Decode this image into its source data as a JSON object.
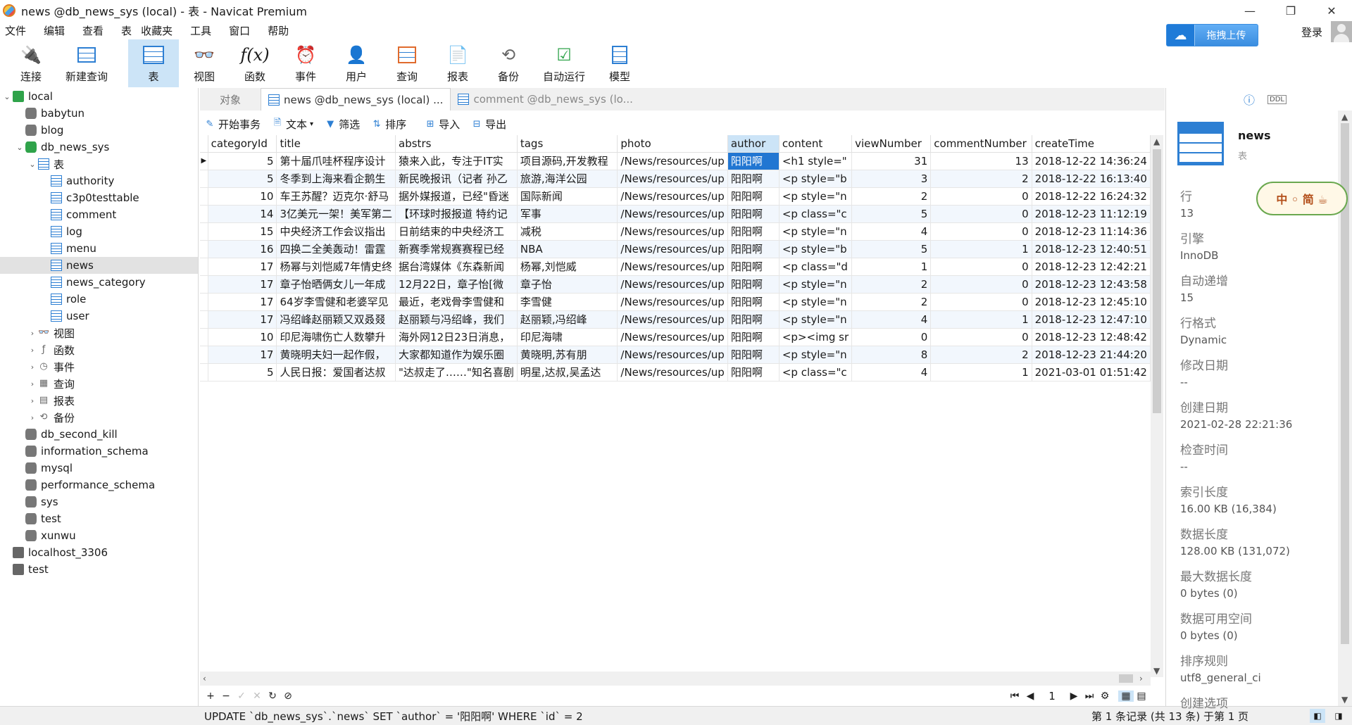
{
  "window": {
    "title": "news @db_news_sys (local) - 表 - Navicat Premium",
    "controls": [
      "—",
      "❐",
      "✕"
    ]
  },
  "menu": [
    "文件",
    "编辑",
    "查看",
    "表",
    "收藏夹",
    "工具",
    "窗口",
    "帮助"
  ],
  "top_right": {
    "upload_label": "拖拽上传",
    "login_label": "登录"
  },
  "toolbar": [
    {
      "label": "连接",
      "icon": "plug-icon"
    },
    {
      "label": "新建查询",
      "icon": "new-query-icon"
    },
    {
      "label": "表",
      "icon": "table-icon",
      "active": true
    },
    {
      "label": "视图",
      "icon": "view-icon"
    },
    {
      "label": "函数",
      "icon": "function-icon"
    },
    {
      "label": "事件",
      "icon": "clock-icon"
    },
    {
      "label": "用户",
      "icon": "user-icon"
    },
    {
      "label": "查询",
      "icon": "query-icon"
    },
    {
      "label": "报表",
      "icon": "report-icon"
    },
    {
      "label": "备份",
      "icon": "backup-icon"
    },
    {
      "label": "自动运行",
      "icon": "automation-icon"
    },
    {
      "label": "模型",
      "icon": "model-icon"
    }
  ],
  "tree": [
    {
      "label": "local",
      "depth": 0,
      "kind": "conn",
      "tw": "⌄"
    },
    {
      "label": "babytun",
      "depth": 1,
      "kind": "db"
    },
    {
      "label": "blog",
      "depth": 1,
      "kind": "db"
    },
    {
      "label": "db_news_sys",
      "depth": 1,
      "kind": "db-open",
      "tw": "⌄"
    },
    {
      "label": "表",
      "depth": 2,
      "kind": "table",
      "tw": "⌄"
    },
    {
      "label": "authority",
      "depth": 3,
      "kind": "table"
    },
    {
      "label": "c3p0testtable",
      "depth": 3,
      "kind": "table"
    },
    {
      "label": "comment",
      "depth": 3,
      "kind": "table"
    },
    {
      "label": "log",
      "depth": 3,
      "kind": "table"
    },
    {
      "label": "menu",
      "depth": 3,
      "kind": "table"
    },
    {
      "label": "news",
      "depth": 3,
      "kind": "table",
      "selected": true
    },
    {
      "label": "news_category",
      "depth": 3,
      "kind": "table"
    },
    {
      "label": "role",
      "depth": 3,
      "kind": "table"
    },
    {
      "label": "user",
      "depth": 3,
      "kind": "table"
    },
    {
      "label": "视图",
      "depth": 2,
      "kind": "view",
      "tw": "›"
    },
    {
      "label": "函数",
      "depth": 2,
      "kind": "func",
      "tw": "›"
    },
    {
      "label": "事件",
      "depth": 2,
      "kind": "event",
      "tw": "›"
    },
    {
      "label": "查询",
      "depth": 2,
      "kind": "query",
      "tw": "›"
    },
    {
      "label": "报表",
      "depth": 2,
      "kind": "report",
      "tw": "›"
    },
    {
      "label": "备份",
      "depth": 2,
      "kind": "backup",
      "tw": "›"
    },
    {
      "label": "db_second_kill",
      "depth": 1,
      "kind": "db"
    },
    {
      "label": "information_schema",
      "depth": 1,
      "kind": "db"
    },
    {
      "label": "mysql",
      "depth": 1,
      "kind": "db"
    },
    {
      "label": "performance_schema",
      "depth": 1,
      "kind": "db"
    },
    {
      "label": "sys",
      "depth": 1,
      "kind": "db"
    },
    {
      "label": "test",
      "depth": 1,
      "kind": "db"
    },
    {
      "label": "xunwu",
      "depth": 1,
      "kind": "db"
    },
    {
      "label": "localhost_3306",
      "depth": 0,
      "kind": "conn-grey"
    },
    {
      "label": "test",
      "depth": 0,
      "kind": "conn-grey"
    }
  ],
  "tabs": {
    "objects": "对象",
    "active": "news @db_news_sys (local) ...",
    "inactive": "comment @db_news_sys (lo..."
  },
  "subtoolbar": {
    "begin_tx": "开始事务",
    "text": "文本",
    "filter": "筛选",
    "sort": "排序",
    "import": "导入",
    "export": "导出"
  },
  "grid": {
    "columns": [
      "categoryId",
      "title",
      "abstrs",
      "tags",
      "photo",
      "author",
      "content",
      "viewNumber",
      "commentNumber",
      "createTime"
    ],
    "rows": [
      [
        "5",
        "第十届爪哇杯程序设计",
        "猿来入此，专注于IT实",
        "项目源码,开发教程",
        "/News/resources/up",
        "阳阳啊",
        "<h1 style=\"",
        "31",
        "13",
        "2018-12-22 14:36:24"
      ],
      [
        "5",
        "冬季到上海来看企鹅生",
        "新民晚报讯（记者 孙乙",
        "旅游,海洋公园",
        "/News/resources/up",
        "阳阳啊",
        "<p style=\"b",
        "3",
        "2",
        "2018-12-22 16:13:40"
      ],
      [
        "10",
        "车王苏醒？迈克尔·舒马",
        "据外媒报道，已经\"昏迷",
        "国际新闻",
        "/News/resources/up",
        "阳阳啊",
        "<p style=\"n",
        "2",
        "0",
        "2018-12-22 16:24:32"
      ],
      [
        "14",
        "3亿美元一架！美军第二",
        "【环球时报报道 特约记",
        "军事",
        "/News/resources/up",
        "阳阳啊",
        "<p class=\"c",
        "5",
        "0",
        "2018-12-23 11:12:19"
      ],
      [
        "15",
        "中央经济工作会议指出",
        "日前结束的中央经济工",
        "减税",
        "/News/resources/up",
        "阳阳啊",
        "<p style=\"n",
        "4",
        "0",
        "2018-12-23 11:14:36"
      ],
      [
        "16",
        "四换二全美轰动！雷霆",
        "新赛季常规赛赛程已经",
        "NBA",
        "/News/resources/up",
        "阳阳啊",
        "<p style=\"b",
        "5",
        "1",
        "2018-12-23 12:40:51"
      ],
      [
        "17",
        "杨幂与刘恺威7年情史终",
        "据台湾媒体《东森新闻",
        "杨幂,刘恺威",
        "/News/resources/up",
        "阳阳啊",
        "<p class=\"d",
        "1",
        "0",
        "2018-12-23 12:42:21"
      ],
      [
        "17",
        "章子怡晒俩女儿一年成",
        "12月22日，章子怡[微",
        "章子怡",
        "/News/resources/up",
        "阳阳啊",
        "<p style=\"n",
        "2",
        "0",
        "2018-12-23 12:43:58"
      ],
      [
        "17",
        "64岁李雪健和老婆罕见",
        "最近，老戏骨李雪健和",
        "李雪健",
        "/News/resources/up",
        "阳阳啊",
        "<p style=\"n",
        "2",
        "0",
        "2018-12-23 12:45:10"
      ],
      [
        "17",
        "冯绍峰赵丽颖又双叒叕",
        "赵丽颖与冯绍峰，我们",
        "赵丽颖,冯绍峰",
        "/News/resources/up",
        "阳阳啊",
        "<p style=\"n",
        "4",
        "1",
        "2018-12-23 12:47:10"
      ],
      [
        "10",
        "印尼海啸伤亡人数攀升",
        "海外网12日23日消息，",
        "印尼海啸",
        "/News/resources/up",
        "阳阳啊",
        "<p><img sr",
        "0",
        "0",
        "2018-12-23 12:48:42"
      ],
      [
        "17",
        "黄晓明夫妇一起作假，",
        "大家都知道作为娱乐圈",
        "黄晓明,苏有朋",
        "/News/resources/up",
        "阳阳啊",
        "<p style=\"n",
        "8",
        "2",
        "2018-12-23 21:44:20"
      ],
      [
        "5",
        "人民日报：爱国者达叔",
        "\"达叔走了……\"知名喜剧",
        "明星,达叔,吴孟达",
        "/News/resources/up",
        "阳阳啊",
        "<p class=\"c",
        "4",
        "1",
        "2021-03-01 01:51:42"
      ]
    ]
  },
  "navbar": {
    "page": "1"
  },
  "status": {
    "sql": "UPDATE `db_news_sys`.`news` SET `author` = '阳阳啊' WHERE `id` = 2",
    "records": "第 1 条记录 (共 13 条) 于第 1 页"
  },
  "info": {
    "name": "news",
    "type": "表",
    "items": [
      {
        "label": "行",
        "value": "13"
      },
      {
        "label": "引擎",
        "value": "InnoDB"
      },
      {
        "label": "自动递增",
        "value": "15"
      },
      {
        "label": "行格式",
        "value": "Dynamic"
      },
      {
        "label": "修改日期",
        "value": "--"
      },
      {
        "label": "创建日期",
        "value": "2021-02-28 22:21:36"
      },
      {
        "label": "检查时间",
        "value": "--"
      },
      {
        "label": "索引长度",
        "value": "16.00 KB (16,384)"
      },
      {
        "label": "数据长度",
        "value": "128.00 KB (131,072)"
      },
      {
        "label": "最大数据长度",
        "value": "0 bytes (0)"
      },
      {
        "label": "数据可用空间",
        "value": "0 bytes (0)"
      },
      {
        "label": "排序规则",
        "value": "utf8_general_ci"
      },
      {
        "label": "创建选项",
        "value": ""
      }
    ],
    "sticker_text": "中 ◦ 简 ☕"
  },
  "colors": {
    "accent": "#2d7fd3",
    "selection": "#2176d2",
    "header_selected": "#cce4f7"
  }
}
